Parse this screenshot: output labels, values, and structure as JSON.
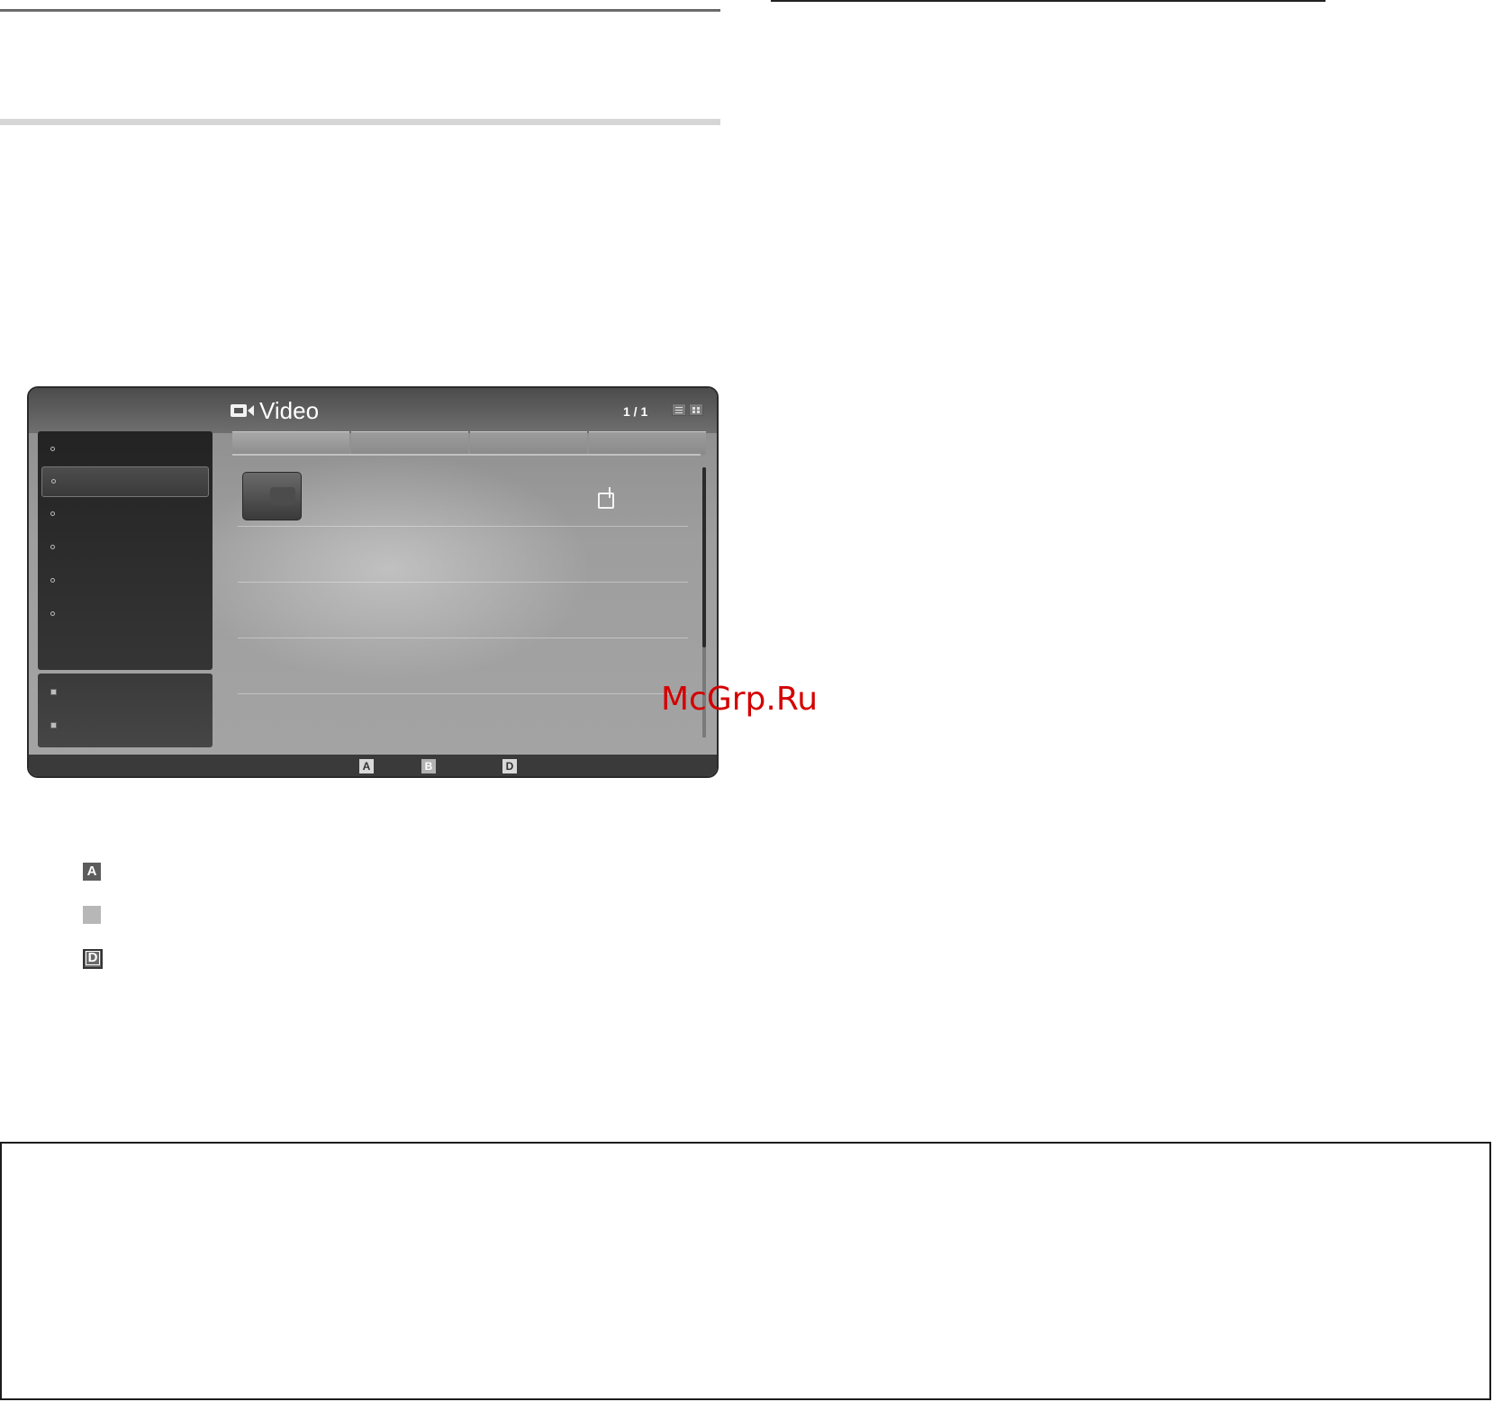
{
  "screen": {
    "title": "Video",
    "title_icon": "video-camera-icon",
    "page_counter": "1 / 1",
    "view_buttons": [
      "list-view-icon",
      "grid-view-icon"
    ],
    "edit_icon": "edit-icon"
  },
  "footer_keys": [
    "A",
    "B",
    "D"
  ],
  "legend_keys": [
    "A",
    "",
    "D"
  ],
  "watermark": "McGrp.Ru"
}
